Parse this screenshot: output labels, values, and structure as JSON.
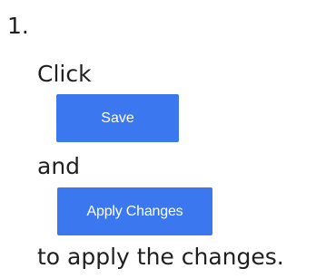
{
  "step": {
    "number": "1.",
    "click_text": "Click",
    "and_text": "and",
    "apply_text": "to apply the changes."
  },
  "buttons": {
    "save_label": "Save",
    "apply_changes_label": "Apply Changes"
  },
  "colors": {
    "button_background": "#3b78f0",
    "button_text": "#ffffff",
    "body_text": "#1f1f1f"
  }
}
